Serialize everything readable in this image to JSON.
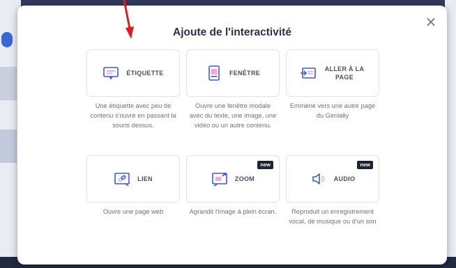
{
  "modal": {
    "title": "Ajoute de l'interactivité",
    "close_label": "×"
  },
  "options": [
    {
      "label": "ÉTIQUETTE",
      "icon": "tooltip-icon",
      "badge": "",
      "description": "Une étiquette avec peu de contenu s'ouvre en passant la souris dessus."
    },
    {
      "label": "FENÊTRE",
      "icon": "window-icon",
      "badge": "",
      "description": "Ouvre une fenêtre modale avec du texte, une image, une vidéo ou un autre contenu."
    },
    {
      "label": "ALLER À LA PAGE",
      "icon": "go-to-page-icon",
      "badge": "",
      "description": "Emmène vers une autre page du Genially"
    },
    {
      "label": "LIEN",
      "icon": "link-icon",
      "badge": "",
      "description": "Ouvre une page web"
    },
    {
      "label": "ZOOM",
      "icon": "zoom-icon",
      "badge": "new",
      "description": "Agrandit l'image à plein écran."
    },
    {
      "label": "AUDIO",
      "icon": "audio-icon",
      "badge": "new",
      "description": "Reproduit un enregistrement vocal, de musique ou d'un son"
    }
  ],
  "colors": {
    "accent": "#3a5bd9",
    "accent_light": "#f3a8d8",
    "arrow": "#e21b1b",
    "badge_bg": "#1e2333"
  }
}
